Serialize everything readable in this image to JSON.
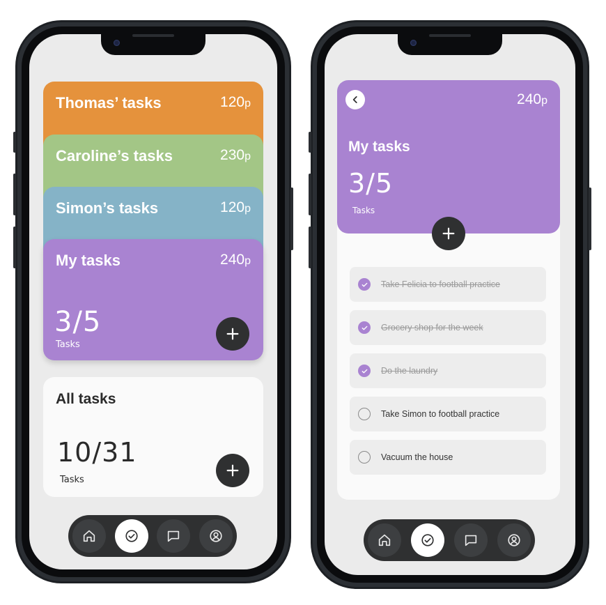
{
  "left_screen": {
    "cards": [
      {
        "title": "Thomas’ tasks",
        "points": "120",
        "unit": "p",
        "color": "#e5923c"
      },
      {
        "title": "Caroline’s tasks",
        "points": "230",
        "unit": "p",
        "color": "#a3c686"
      },
      {
        "title": "Simon’s tasks",
        "points": "120",
        "unit": "p",
        "color": "#85b3c7"
      },
      {
        "title": "My tasks",
        "points": "240",
        "unit": "p",
        "color": "#a983d1",
        "count": "3/5",
        "count_label": "Tasks"
      }
    ],
    "all_tasks": {
      "title": "All tasks",
      "count": "10/31",
      "count_label": "Tasks"
    }
  },
  "right_screen": {
    "header": {
      "title": "My tasks",
      "points": "240",
      "unit": "p",
      "count": "3/5",
      "count_label": "Tasks",
      "color": "#a983d1"
    },
    "tasks": [
      {
        "text": "Take Felicia to football practice",
        "done": true
      },
      {
        "text": "Grocery shop for the week",
        "done": true
      },
      {
        "text": "Do the laundry",
        "done": true
      },
      {
        "text": "Take Simon to football practice",
        "done": false
      },
      {
        "text": "Vacuum  the house",
        "done": false
      }
    ]
  },
  "nav": {
    "items": [
      "home-icon",
      "check-circle-icon",
      "chat-icon",
      "profile-icon"
    ],
    "active": "check-circle-icon"
  },
  "colors": {
    "nav_bg": "#2f3031",
    "screen_bg": "#ebebeb",
    "accent": "#a983d1"
  }
}
